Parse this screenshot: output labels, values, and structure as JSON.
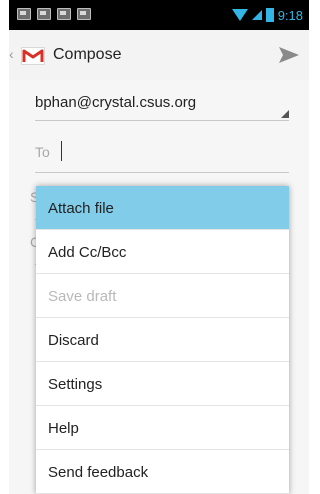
{
  "status_bar": {
    "time": "9:18",
    "left_icons": [
      "image-icon",
      "check-icon",
      "mail-icon",
      "download-icon"
    ],
    "right_icons": [
      "wifi-icon",
      "signal-icon",
      "battery-icon"
    ]
  },
  "action_bar": {
    "title": "Compose",
    "app_icon": "gmail-icon",
    "send_icon": "send-icon"
  },
  "compose": {
    "from_account": "bphan@crystal.csus.org",
    "to_label": "To",
    "subject_hint_initial": "S",
    "body_hint_initial": "C"
  },
  "menu": {
    "items": [
      {
        "label": "Attach file",
        "state": "selected"
      },
      {
        "label": "Add Cc/Bcc",
        "state": "enabled"
      },
      {
        "label": "Save draft",
        "state": "disabled"
      },
      {
        "label": "Discard",
        "state": "enabled"
      },
      {
        "label": "Settings",
        "state": "enabled"
      },
      {
        "label": "Help",
        "state": "enabled"
      },
      {
        "label": "Send feedback",
        "state": "enabled"
      }
    ]
  },
  "colors": {
    "accent": "#33b5e5",
    "menu_selected": "#81cce9",
    "gmail_red": "#d93025"
  }
}
